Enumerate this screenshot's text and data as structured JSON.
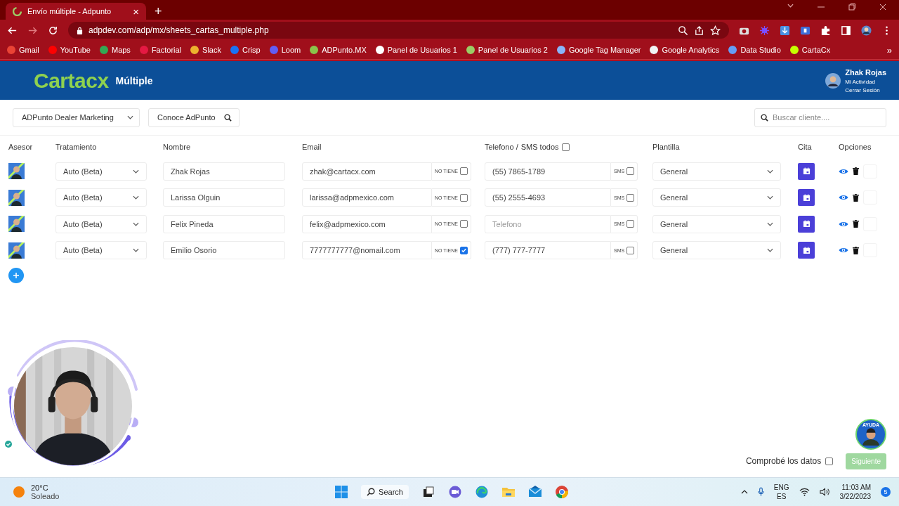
{
  "browser": {
    "tab": {
      "title": "Envío múltiple - Adpunto",
      "close": "×"
    },
    "new_tab": "+",
    "address": "adpdev.com/adp/mx/sheets_cartas_multiple.php",
    "bookmarks": [
      {
        "label": "Gmail",
        "color": "#ea4335"
      },
      {
        "label": "YouTube",
        "color": "#ff0000"
      },
      {
        "label": "Maps",
        "color": "#34a853"
      },
      {
        "label": "Factorial",
        "color": "#e51943"
      },
      {
        "label": "Slack",
        "color": "#ecb22e"
      },
      {
        "label": "Crisp",
        "color": "#1972f5"
      },
      {
        "label": "Loom",
        "color": "#625df5"
      },
      {
        "label": "ADPunto.MX",
        "color": "#8bc34a"
      },
      {
        "label": "Panel de Usuarios 1",
        "color": "#ffffff"
      },
      {
        "label": "Panel de Usuarios 2",
        "color": "#9ccc65"
      },
      {
        "label": "Google Tag Manager",
        "color": "#8ab4f8"
      },
      {
        "label": "Google Analytics",
        "color": "#f1f3f4"
      },
      {
        "label": "Data Studio",
        "color": "#669df6"
      },
      {
        "label": "CartaCx",
        "color": "#c6ff00"
      }
    ],
    "more": "»"
  },
  "app": {
    "logo": "Cartacx",
    "title": "Múltiple",
    "user": {
      "name": "Zhak Rojas",
      "links": [
        "Mi Actividad",
        "Cerrar Sesión"
      ]
    }
  },
  "toolbar": {
    "account_select": "ADPunto Dealer Marketing",
    "about_button": "Conoce AdPunto",
    "search": {
      "placeholder": "Buscar cliente...."
    }
  },
  "table": {
    "columns": [
      "Asesor",
      "Tratamiento",
      "Nombre",
      "Email",
      "Telefono /",
      "Plantilla",
      "Cita",
      "Opciones"
    ],
    "sms_all": {
      "label": "SMS todos",
      "checked": false
    },
    "rows": [
      {
        "treatment": "Auto (Beta)",
        "name": "Zhak Rojas",
        "email": "zhak@cartacx.com",
        "no_email": {
          "label": "NO TIENE",
          "checked": false
        },
        "phone": {
          "value": "(55) 7865-1789"
        },
        "sms": {
          "label": "SMS",
          "checked": false
        },
        "template": "General"
      },
      {
        "treatment": "Auto (Beta)",
        "name": "Larissa Olguin",
        "email": "larissa@adpmexico.com",
        "no_email": {
          "label": "NO TIENE",
          "checked": false
        },
        "phone": {
          "value": "(55) 2555-4693"
        },
        "sms": {
          "label": "SMS",
          "checked": false
        },
        "template": "General"
      },
      {
        "treatment": "Auto (Beta)",
        "name": "Felix Pineda",
        "email": "felix@adpmexico.com",
        "no_email": {
          "label": "NO TIENE",
          "checked": false
        },
        "phone": {
          "placeholder": "Telefono"
        },
        "sms": {
          "label": "SMS",
          "checked": false
        },
        "template": "General"
      },
      {
        "treatment": "Auto (Beta)",
        "name": "Emilio Osorio",
        "email": "7777777777@nomail.com",
        "no_email": {
          "label": "NO TIENE",
          "checked": true
        },
        "phone": {
          "value": "(777) 777-7777"
        },
        "sms": {
          "label": "SMS",
          "checked": false
        },
        "template": "General"
      }
    ]
  },
  "footer": {
    "confirm": {
      "label": "Comprobé los datos",
      "checked": false
    },
    "next_button": {
      "label": "Siguiente",
      "disabled": true
    },
    "help_badge": "AYUDA"
  },
  "taskbar": {
    "weather": {
      "temp": "20°C",
      "condition": "Soleado"
    },
    "search": "Search",
    "language": [
      "ENG",
      "ES"
    ],
    "time": "11:03 AM",
    "date": "3/22/2023",
    "notifications": "5"
  }
}
